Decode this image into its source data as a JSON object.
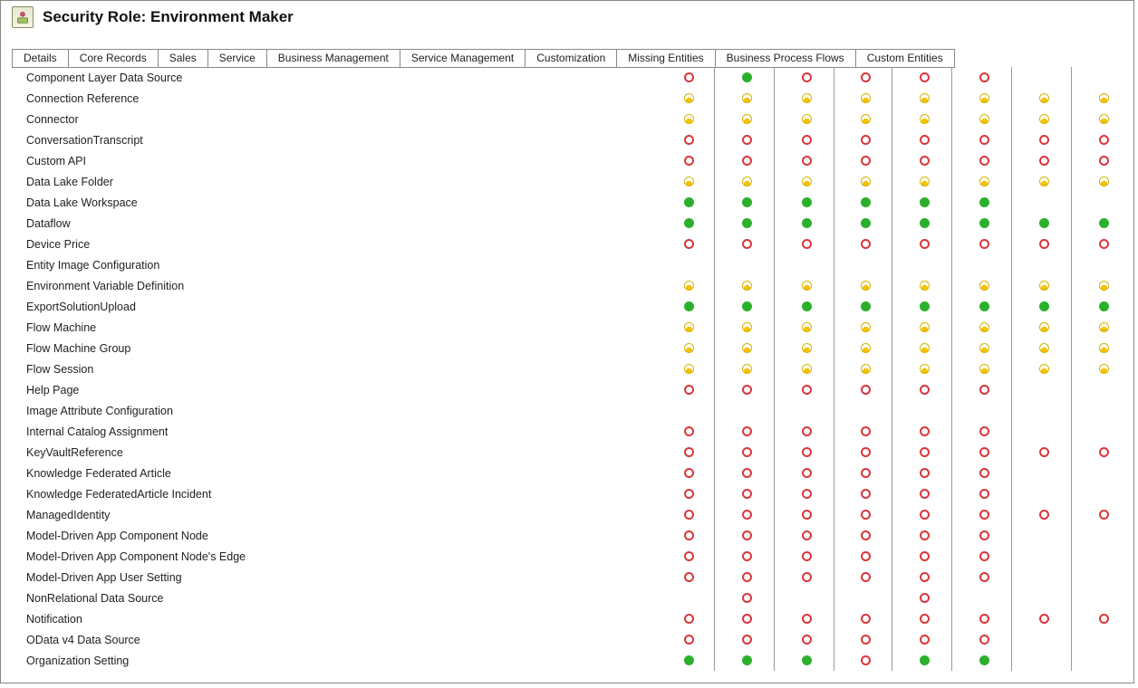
{
  "header": {
    "title": "Security Role: Environment Maker"
  },
  "tabs": [
    "Details",
    "Core Records",
    "Sales",
    "Service",
    "Business Management",
    "Service Management",
    "Customization",
    "Missing Entities",
    "Business Process Flows",
    "Custom Entities"
  ],
  "rows": [
    {
      "label": "Component Layer Data Source",
      "perms": [
        "none",
        "green",
        "",
        "none",
        "none",
        "",
        "none",
        "none"
      ]
    },
    {
      "label": "Connection Reference",
      "perms": [
        "yellow",
        "yellow",
        "",
        "yellow",
        "yellow",
        "",
        "yellow",
        "yellow",
        "yellow",
        "yellow"
      ]
    },
    {
      "label": "Connector",
      "perms": [
        "yellow",
        "yellow",
        "",
        "yellow",
        "yellow",
        "",
        "yellow",
        "yellow",
        "yellow",
        "yellow"
      ]
    },
    {
      "label": "ConversationTranscript",
      "perms": [
        "none",
        "none",
        "",
        "none",
        "none",
        "",
        "none",
        "none",
        "none",
        "none"
      ]
    },
    {
      "label": "Custom API",
      "perms": [
        "none",
        "none",
        "",
        "none",
        "none",
        "",
        "none",
        "none",
        "none",
        "none"
      ]
    },
    {
      "label": "Data Lake Folder",
      "perms": [
        "yellow",
        "yellow",
        "",
        "yellow",
        "yellow",
        "",
        "yellow",
        "yellow",
        "yellow",
        "yellow"
      ]
    },
    {
      "label": "Data Lake Workspace",
      "perms": [
        "green",
        "green",
        "",
        "green",
        "green",
        "",
        "green",
        "green"
      ]
    },
    {
      "label": "Dataflow",
      "perms": [
        "green",
        "green",
        "",
        "green",
        "green",
        "",
        "green",
        "green",
        "green",
        "green"
      ]
    },
    {
      "label": "Device Price",
      "perms": [
        "none",
        "none",
        "",
        "none",
        "none",
        "",
        "none",
        "none",
        "none",
        "none"
      ]
    },
    {
      "label": "Entity Image Configuration",
      "perms": []
    },
    {
      "label": "Environment Variable Definition",
      "perms": [
        "yellow",
        "yellow",
        "",
        "yellow",
        "yellow",
        "",
        "yellow",
        "yellow",
        "yellow",
        "yellow"
      ]
    },
    {
      "label": "ExportSolutionUpload",
      "perms": [
        "green",
        "green",
        "",
        "green",
        "green",
        "",
        "green",
        "green",
        "green",
        "green"
      ]
    },
    {
      "label": "Flow Machine",
      "perms": [
        "yellow",
        "yellow",
        "",
        "yellow",
        "yellow",
        "",
        "yellow",
        "yellow",
        "yellow",
        "yellow"
      ]
    },
    {
      "label": "Flow Machine Group",
      "perms": [
        "yellow",
        "yellow",
        "",
        "yellow",
        "yellow",
        "",
        "yellow",
        "yellow",
        "yellow",
        "yellow"
      ]
    },
    {
      "label": "Flow Session",
      "perms": [
        "yellow",
        "yellow",
        "",
        "yellow",
        "yellow",
        "",
        "yellow",
        "yellow",
        "yellow",
        "yellow"
      ]
    },
    {
      "label": "Help Page",
      "perms": [
        "none",
        "none",
        "",
        "none",
        "none",
        "",
        "none",
        "none"
      ]
    },
    {
      "label": "Image Attribute Configuration",
      "perms": []
    },
    {
      "label": "Internal Catalog Assignment",
      "perms": [
        "none",
        "none",
        "",
        "none",
        "none",
        "",
        "none",
        "none"
      ]
    },
    {
      "label": "KeyVaultReference",
      "perms": [
        "none",
        "none",
        "",
        "none",
        "none",
        "",
        "none",
        "none",
        "none",
        "none"
      ]
    },
    {
      "label": "Knowledge Federated Article",
      "perms": [
        "none",
        "none",
        "",
        "none",
        "none",
        "",
        "none",
        "none"
      ]
    },
    {
      "label": "Knowledge FederatedArticle Incident",
      "perms": [
        "none",
        "none",
        "",
        "none",
        "none",
        "",
        "none",
        "none"
      ]
    },
    {
      "label": "ManagedIdentity",
      "perms": [
        "none",
        "none",
        "",
        "none",
        "none",
        "",
        "none",
        "none",
        "none",
        "none"
      ]
    },
    {
      "label": "Model-Driven App Component Node",
      "perms": [
        "none",
        "none",
        "",
        "none",
        "none",
        "",
        "none",
        "none"
      ]
    },
    {
      "label": "Model-Driven App Component Node's Edge",
      "perms": [
        "none",
        "none",
        "",
        "none",
        "none",
        "",
        "none",
        "none"
      ]
    },
    {
      "label": "Model-Driven App User Setting",
      "perms": [
        "none",
        "none",
        "",
        "none",
        "none",
        "",
        "none",
        "none"
      ]
    },
    {
      "label": "NonRelational Data Source",
      "perms": [
        "",
        "none",
        "",
        "",
        "",
        "",
        "none",
        ""
      ]
    },
    {
      "label": "Notification",
      "perms": [
        "none",
        "none",
        "",
        "none",
        "none",
        "",
        "none",
        "none",
        "none",
        "none"
      ]
    },
    {
      "label": "OData v4 Data Source",
      "perms": [
        "none",
        "none",
        "",
        "none",
        "none",
        "",
        "none",
        "none"
      ]
    },
    {
      "label": "Organization Setting",
      "perms": [
        "green",
        "green",
        "",
        "green",
        "none",
        "",
        "green",
        "green"
      ]
    }
  ]
}
